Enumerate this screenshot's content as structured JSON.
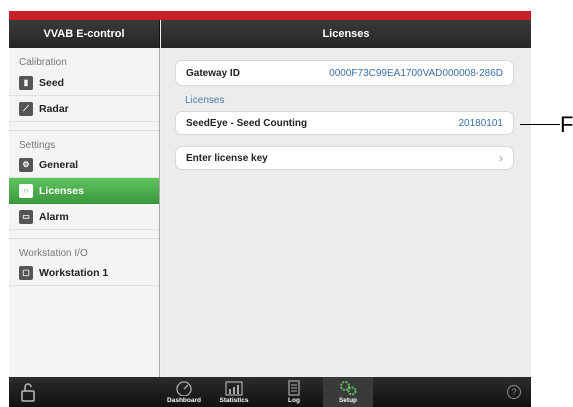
{
  "sidebar": {
    "title": "VVAB E-control",
    "sections": [
      {
        "label": "Calibration",
        "items": [
          {
            "label": "Seed",
            "icon": "seed-icon"
          },
          {
            "label": "Radar",
            "icon": "radar-icon"
          }
        ]
      },
      {
        "label": "Settings",
        "items": [
          {
            "label": "General",
            "icon": "gears-icon"
          },
          {
            "label": "Licenses",
            "icon": "license-icon",
            "active": true
          },
          {
            "label": "Alarm",
            "icon": "alarm-icon"
          }
        ]
      },
      {
        "label": "Workstation I/O",
        "items": [
          {
            "label": "Workstation 1",
            "icon": "workstation-icon"
          }
        ]
      }
    ]
  },
  "main": {
    "title": "Licenses",
    "gateway": {
      "label": "Gateway ID",
      "value": "0000F73C99EA1700VAD000008-286D"
    },
    "licenses_header": "Licenses",
    "license": {
      "name": "SeedEye - Seed Counting",
      "value": "20180101"
    },
    "enter_key": {
      "label": "Enter license key"
    }
  },
  "tabbar": {
    "tabs": [
      {
        "label": "Dashboard",
        "icon": "dashboard-icon"
      },
      {
        "label": "Statistics",
        "icon": "statistics-icon"
      },
      {
        "label": "Log",
        "icon": "log-icon"
      },
      {
        "label": "Setup",
        "icon": "setup-icon",
        "active": true
      }
    ],
    "help": "?"
  },
  "callout": {
    "label": "F"
  },
  "colors": {
    "accent_red": "#c72027",
    "active_green": "#4caf50",
    "value_blue": "#3a6ea5"
  }
}
